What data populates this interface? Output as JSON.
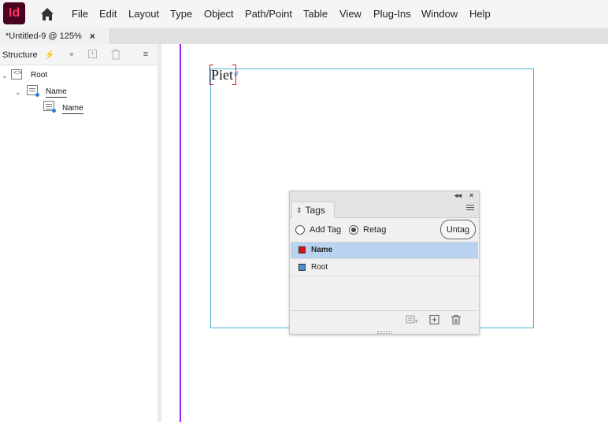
{
  "app": {
    "logo_text": "Id",
    "brand_color": "#49021f",
    "logo_text_color": "#ff3366"
  },
  "menu": {
    "items": [
      "File",
      "Edit",
      "Layout",
      "Type",
      "Object",
      "Path/Point",
      "Table",
      "View",
      "Plug-Ins",
      "Window",
      "Help"
    ]
  },
  "document_tab": {
    "title": "*Untitled-9 @ 125%",
    "close_icon": "close-icon"
  },
  "structure_panel": {
    "title": "Structure",
    "toolbar_icons": [
      "lightning-icon",
      "circle-icon",
      "add-attribute-icon",
      "trash-icon",
      "panel-menu-icon"
    ],
    "tree": [
      {
        "label": "Root",
        "icon": "xml-root-icon",
        "expanded": true
      },
      {
        "label": "Name",
        "icon": "text-frame-element-icon",
        "expanded": true
      },
      {
        "label": "Name",
        "icon": "text-element-icon"
      }
    ]
  },
  "canvas": {
    "frame_text": "Piet",
    "margin_color": "#a020f0",
    "frame_color": "#4fb3d8",
    "tag_bracket_color": "#dd1111"
  },
  "tags_panel": {
    "tab_label": "Tags",
    "add_tag_label": "Add Tag",
    "retag_label": "Retag",
    "selected_mode": "Retag",
    "untag_label": "Untag",
    "tags": [
      {
        "name": "Name",
        "color": "#dd1111",
        "selected": true
      },
      {
        "name": "Root",
        "color": "#4a90d9",
        "selected": false
      }
    ],
    "footer_icons": [
      "new-tag-from-selection-icon",
      "new-tag-icon",
      "trash-icon"
    ],
    "selected_row_color": "#b8d2f0"
  }
}
